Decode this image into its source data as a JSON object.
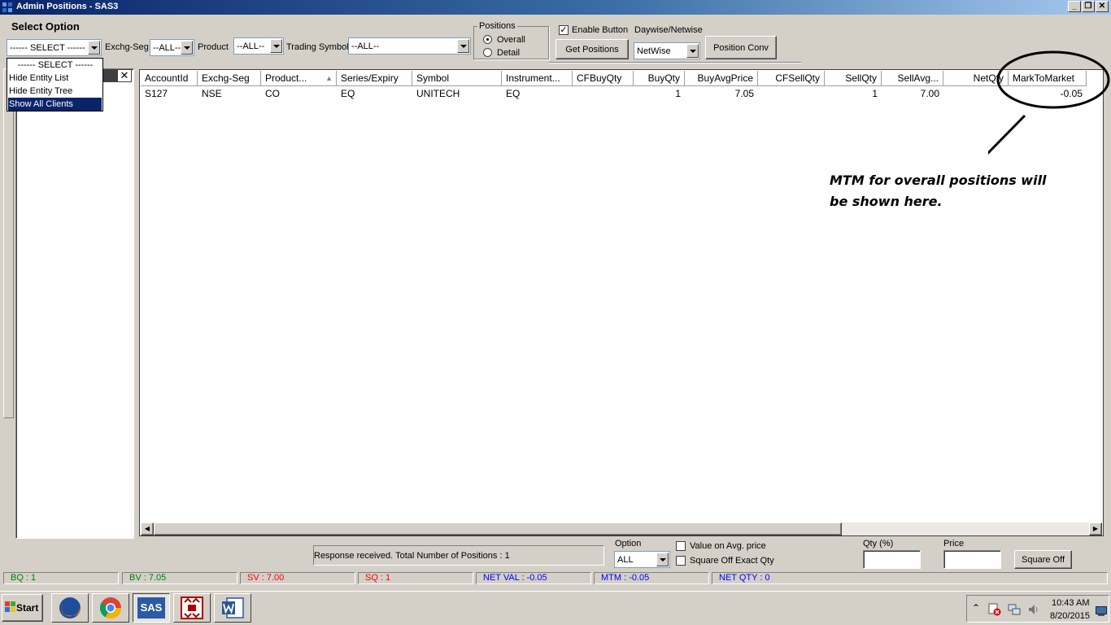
{
  "window": {
    "title": "Admin Positions - SAS3"
  },
  "filters": {
    "select_option_label": "Select Option",
    "select_value": "------ SELECT ------",
    "dropdown_options": [
      "------ SELECT ------",
      "Hide Entity List",
      "Hide Entity Tree",
      "Show All Clients"
    ],
    "exchg_seg_label": "Exchg-Seg",
    "exchg_seg_value": "--ALL--",
    "product_label": "Product",
    "product_value": "--ALL--",
    "trading_symbol_label": "Trading Symbol",
    "trading_symbol_value": "--ALL--"
  },
  "positions_group": {
    "title": "Positions",
    "overall_label": "Overall",
    "detail_label": "Detail",
    "selected": "Overall"
  },
  "actions": {
    "enable_button_label": "Enable Button",
    "enable_button_checked": true,
    "get_positions_label": "Get Positions",
    "daywise_netwise_label": "Daywise/Netwise",
    "netwise_value": "NetWise",
    "position_conv_label": "Position Conv"
  },
  "grid": {
    "columns": [
      "AccountId",
      "Exchg-Seg",
      "Product...",
      "Series/Expiry",
      "Symbol",
      "Instrument...",
      "CFBuyQty",
      "BuyQty",
      "BuyAvgPrice",
      "CFSellQty",
      "SellQty",
      "SellAvg...",
      "NetQty",
      "MarkToMarket"
    ],
    "rows": [
      [
        "S127",
        "NSE",
        "CO",
        "EQ",
        "UNITECH",
        "EQ",
        "",
        "1",
        "7.05",
        "",
        "1",
        "7.00",
        "",
        "-0.05"
      ]
    ]
  },
  "bottom": {
    "response_text": "Response received. Total Number of Positions : 1",
    "option_label": "Option",
    "option_value": "ALL",
    "value_on_avg_label": "Value on Avg. price",
    "square_off_exact_label": "Square Off Exact Qty",
    "qty_label": "Qty (%)",
    "price_label": "Price",
    "square_off_label": "Square Off"
  },
  "status_bar": {
    "bq": "BQ : 1",
    "bv": "BV : 7.05",
    "sv": "SV : 7.00",
    "sq": "SQ : 1",
    "net_val": "NET VAL : -0.05",
    "mtm": "MTM : -0.05",
    "net_qty": "NET QTY : 0",
    "colors": {
      "green": "#008000",
      "red": "#ff0000",
      "blue": "#0000ff"
    }
  },
  "annotation": {
    "text_line1": "MTM for overall positions will",
    "text_line2": "be shown here."
  },
  "taskbar": {
    "start_label": "Start",
    "sas_label": "SAS",
    "time": "10:43 AM",
    "date": "8/20/2015",
    "apps": [
      "firefox-icon",
      "chrome-icon",
      "sas-icon",
      "nw-icon",
      "word-icon"
    ]
  }
}
